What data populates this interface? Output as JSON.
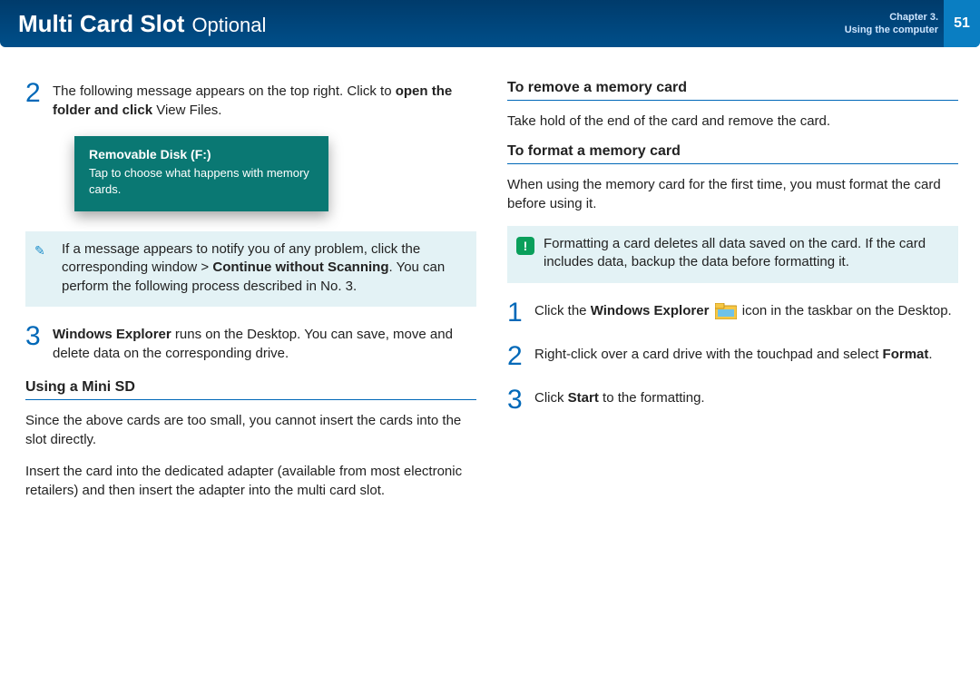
{
  "header": {
    "title": "Multi Card Slot",
    "subtitle": "Optional",
    "chapter_line1": "Chapter 3.",
    "chapter_line2": "Using the computer",
    "page_number": "51"
  },
  "left": {
    "step2": {
      "num": "2",
      "text_a": "The following message appears on the top right. Click to ",
      "text_b_bold": "open the folder and click",
      "text_c": " View Files."
    },
    "toast": {
      "title": "Removable Disk (F:)",
      "body": "Tap to choose what happens with memory cards."
    },
    "note": {
      "text_a": "If a message appears to notify you of any problem, click the corresponding window > ",
      "text_b_bold": "Continue without Scanning",
      "text_c": ". You can perform the following process described in No. 3."
    },
    "step3": {
      "num": "3",
      "bold": "Windows Explorer",
      "text": " runs on the Desktop. You can save, move and delete data on the corresponding drive."
    },
    "mini_sd": {
      "heading": "Using a Mini SD",
      "p1": "Since the above cards are too small, you cannot insert the cards into the slot directly.",
      "p2": "Insert the card into the dedicated adapter (available from most electronic retailers) and then insert the adapter into the multi card slot."
    }
  },
  "right": {
    "remove": {
      "heading": "To remove a memory card",
      "p1": "Take hold of the end of the card and remove the card."
    },
    "format": {
      "heading": "To format a memory card",
      "p1": "When using the memory card for the first time, you must format the card before using it.",
      "warn": "Formatting a card deletes all data saved on the card. If the card includes data, backup the data before formatting it.",
      "step1": {
        "num": "1",
        "a": "Click the ",
        "b_bold": "Windows Explorer",
        "c": " icon in the taskbar on the Desktop."
      },
      "step2": {
        "num": "2",
        "a": "Right-click over a card drive with the touchpad and select ",
        "b_bold": "Format",
        "c": "."
      },
      "step3": {
        "num": "3",
        "a": "Click ",
        "b_bold": "Start",
        "c": " to the formatting."
      }
    }
  }
}
